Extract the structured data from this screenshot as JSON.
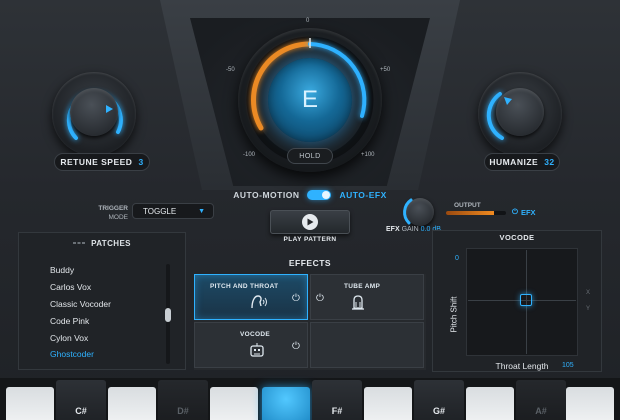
{
  "retune_speed": {
    "label": "RETUNE SPEED",
    "value": "3"
  },
  "humanize": {
    "label": "HUMANIZE",
    "value": "32"
  },
  "dial": {
    "note": "E",
    "hold_label": "HOLD",
    "scale_top": "0",
    "scale_left": "-50",
    "scale_right": "+50",
    "scale_bottom_left": "-100",
    "scale_bottom_right": "+100"
  },
  "auto": {
    "motion_label": "AUTO-MOTION",
    "efx_label": "AUTO-EFX"
  },
  "trigger": {
    "label_line1": "TRIGGER",
    "label_line2": "MODE",
    "value": "TOGGLE"
  },
  "play": {
    "label": "PLAY PATTERN"
  },
  "efx": {
    "gain_label": "EFX",
    "gain_sub": "GAIN",
    "gain_value": "0.0 dB",
    "output_label": "OUTPUT",
    "output_level": 0.8,
    "button_label": "EFX"
  },
  "patches": {
    "title": "PATCHES",
    "items": [
      "Buddy",
      "Carlos Vox",
      "Classic Vocoder",
      "Code Pink",
      "Cylon Vox",
      "Ghostcoder"
    ],
    "active_index": 5
  },
  "effects": {
    "title": "EFFECTS",
    "cells": [
      {
        "label": "PITCH AND THROAT",
        "on": true
      },
      {
        "label": "TUBE AMP",
        "on": false
      },
      {
        "label": "VOCODE",
        "on": false
      }
    ]
  },
  "vocode": {
    "title": "VOCODE",
    "y_label": "Pitch Shift",
    "x_label": "Throat Length",
    "y_value": "0",
    "x_value": "105",
    "side_x": "X",
    "side_y": "Y"
  },
  "keyboard": {
    "black_keys": [
      "C#",
      "D#",
      "F#",
      "G#",
      "A#"
    ]
  },
  "colors": {
    "accent": "#2fb2ff",
    "orange": "#f08a20"
  }
}
